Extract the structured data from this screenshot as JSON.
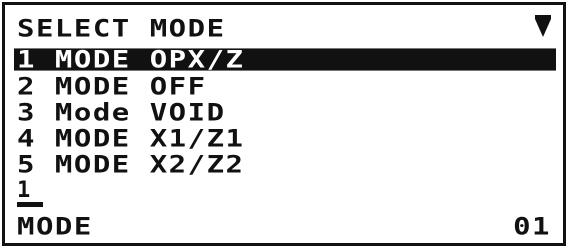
{
  "screen": {
    "title": "SELECT MODE",
    "scroll_icon": "scroll-down-triangle"
  },
  "menu": {
    "items": [
      {
        "label": "1 MODE OPX/Z",
        "selected": true
      },
      {
        "label": "2 MODE OFF",
        "selected": false
      },
      {
        "label": "3 Mode VOID",
        "selected": false
      },
      {
        "label": "4 MODE X1/Z1",
        "selected": false
      },
      {
        "label": "5 MODE X2/Z2",
        "selected": false
      }
    ]
  },
  "input": {
    "value": "1"
  },
  "status": {
    "left": "MODE",
    "right": "01"
  },
  "colors": {
    "foreground": "#111111",
    "background": "#ffffff",
    "highlight_text": "#ffffff"
  }
}
